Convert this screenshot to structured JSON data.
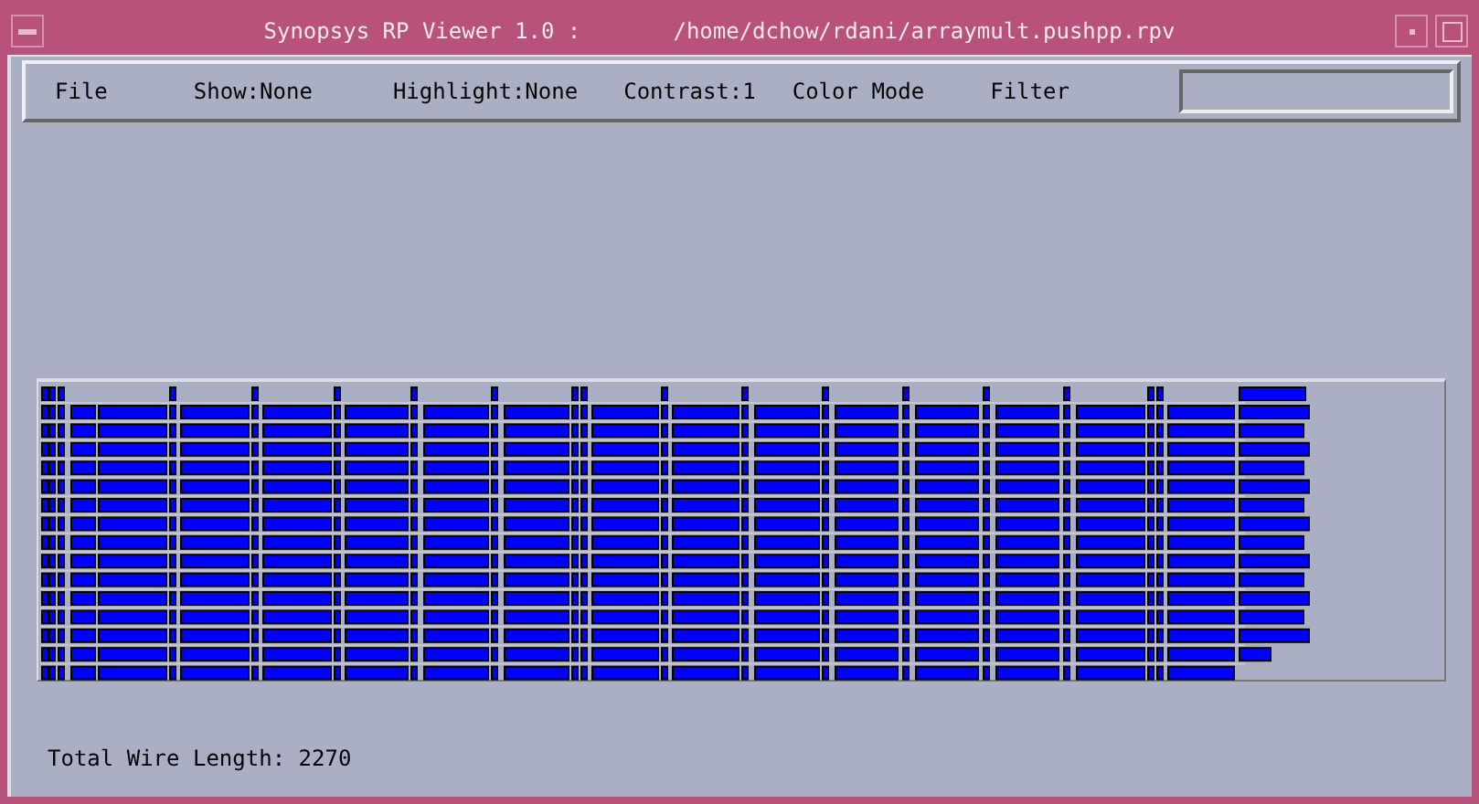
{
  "window": {
    "title": "Synopsys RP Viewer 1.0 :       /home/dchow/rdani/arraymult.pushpp.rpv"
  },
  "menu": [
    "File",
    "Show:None",
    "Highlight:None",
    "Contrast:1",
    "Color Mode"
  ],
  "filter": {
    "label": "Filter"
  },
  "status_bar": {
    "text": "Total Wire Length: 2270"
  }
}
